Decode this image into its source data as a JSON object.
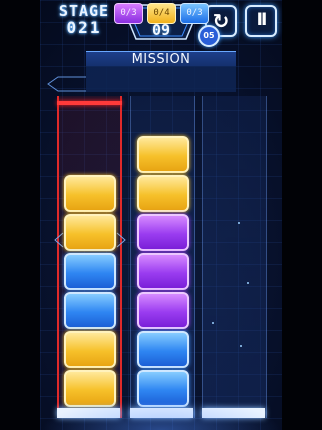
{
  "header": {
    "stage_label": "STAGE",
    "stage_number": "021",
    "moves_icon": "swap-arrows-icon",
    "moves_glyph": "⇆",
    "moves_count": "09",
    "undo_glyph": "↻",
    "undo_count": "05",
    "pause_glyph": "II"
  },
  "mission": {
    "title": "MISSION",
    "items": [
      {
        "color": "purple",
        "progress": "0/3"
      },
      {
        "color": "yellow",
        "progress": "0/4"
      },
      {
        "color": "blue",
        "progress": "0/3"
      }
    ]
  },
  "columns": [
    {
      "selected": true,
      "tiles_top_to_bottom": [
        "yellow",
        "yellow",
        "blue",
        "blue",
        "yellow",
        "yellow"
      ]
    },
    {
      "selected": false,
      "tiles_top_to_bottom": [
        "yellow",
        "yellow",
        "purple",
        "purple",
        "purple",
        "blue",
        "blue"
      ]
    },
    {
      "selected": false,
      "tiles_top_to_bottom": []
    }
  ],
  "colors": {
    "yellow": "#f6c12a",
    "blue": "#2f86f2",
    "purple": "#9a3cf0",
    "selected_column": "#e02a2a"
  }
}
